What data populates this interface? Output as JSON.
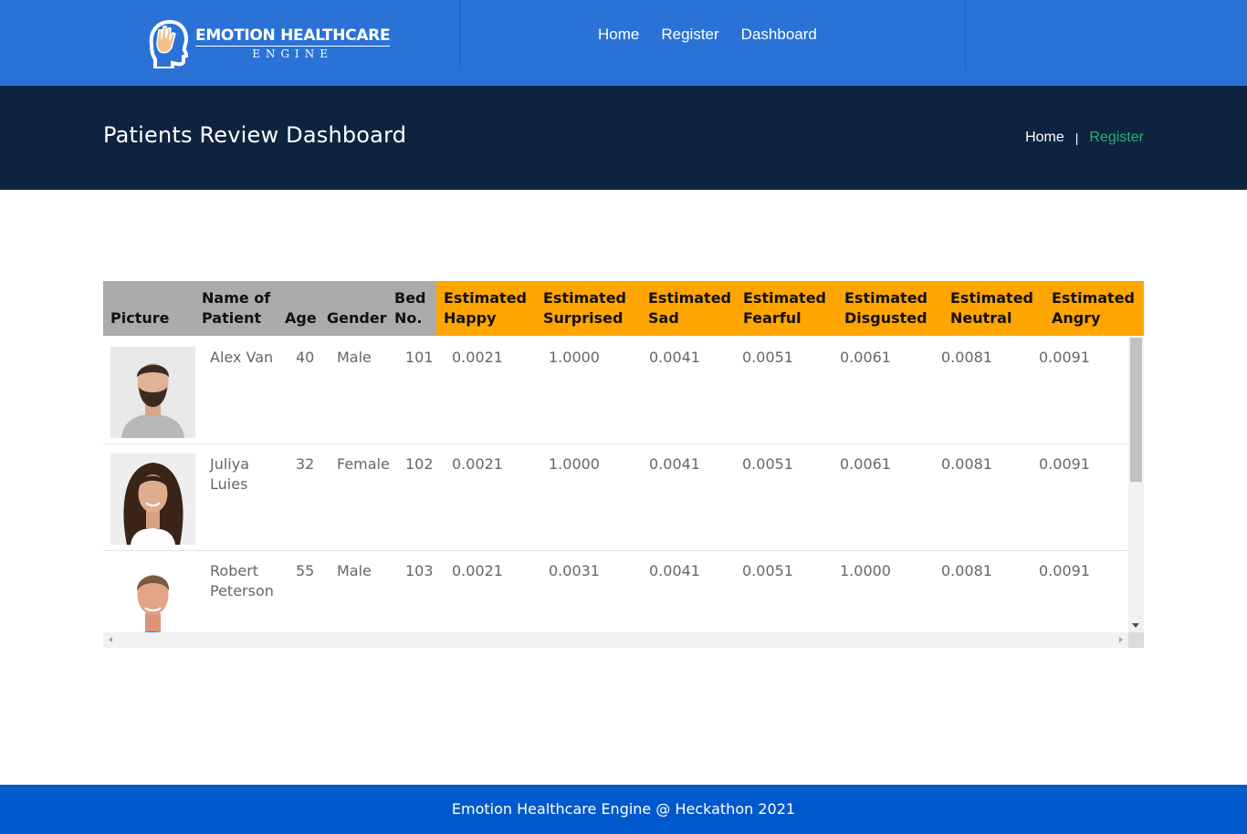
{
  "brand": {
    "title": "EMOTION HEALTHCARE",
    "subtitle": "ENGINE",
    "logo_icon": "head-with-hand-icon"
  },
  "nav": {
    "home": "Home",
    "register": "Register",
    "dashboard": "Dashboard"
  },
  "banner": {
    "title": "Patients Review Dashboard",
    "breadcrumb_home": "Home",
    "breadcrumb_sep": "|",
    "breadcrumb_current": "Register"
  },
  "table": {
    "headers": {
      "picture": "Picture",
      "name_1": "Name of",
      "name_2": "Patient",
      "age": "Age",
      "gender": "Gender",
      "bed_1": "Bed",
      "bed_2": "No.",
      "est": "Estimated",
      "happy": "Happy",
      "surprised": "Surprised",
      "sad": "Sad",
      "fearful": "Fearful",
      "disgusted": "Disgusted",
      "neutral": "Neutral",
      "angry": "Angry"
    },
    "rows": [
      {
        "name_1": "Alex Van",
        "name_2": "",
        "age": "40",
        "gender": "Male",
        "bed": "101",
        "happy": "0.0021",
        "surprised": "1.0000",
        "sad": "0.0041",
        "fearful": "0.0051",
        "disgusted": "0.0061",
        "neutral": "0.0081",
        "angry": "0.0091"
      },
      {
        "name_1": "Juliya",
        "name_2": "Luies",
        "age": "32",
        "gender": "Female",
        "bed": "102",
        "happy": "0.0021",
        "surprised": "1.0000",
        "sad": "0.0041",
        "fearful": "0.0051",
        "disgusted": "0.0061",
        "neutral": "0.0081",
        "angry": "0.0091"
      },
      {
        "name_1": "Robert",
        "name_2": "Peterson",
        "age": "55",
        "gender": "Male",
        "bed": "103",
        "happy": "0.0021",
        "surprised": "0.0031",
        "sad": "0.0041",
        "fearful": "0.0051",
        "disgusted": "1.0000",
        "neutral": "0.0081",
        "angry": "0.0091"
      }
    ]
  },
  "footer": {
    "text": "Emotion Healthcare Engine @ Heckathon 2021"
  },
  "colors": {
    "topbar": "#2a72d5",
    "banner": "#0e2340",
    "accent_green": "#22b573",
    "header_gray": "#ababab",
    "header_orange": "#ffa500",
    "footer": "#0059cc"
  }
}
